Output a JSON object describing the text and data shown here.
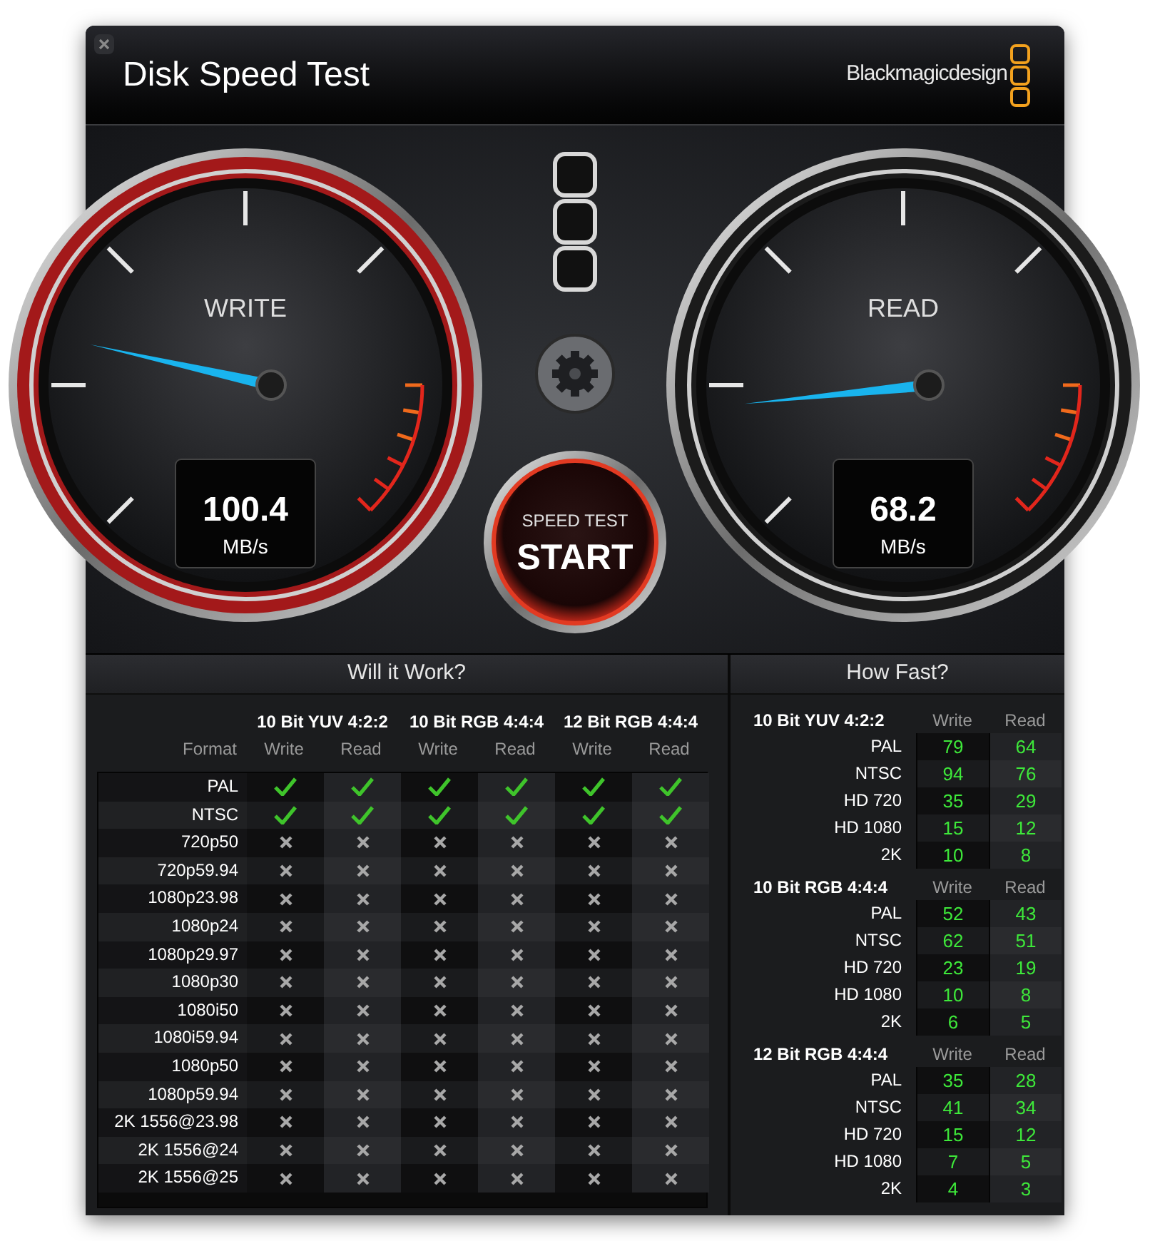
{
  "window": {
    "title": "Disk Speed Test",
    "brand": "Blackmagicdesign"
  },
  "gauges": [
    {
      "label": "WRITE",
      "value": "100.4",
      "unit": "MB/s",
      "color": "#a3191a"
    },
    {
      "label": "READ",
      "value": "68.2",
      "unit": "MB/s",
      "color": "#1b1b1b"
    }
  ],
  "start_button": {
    "caption": "SPEED TEST",
    "label": "START"
  },
  "will_it_work": {
    "title": "Will it Work?",
    "format_header": "Format",
    "groups": [
      {
        "name": "10 Bit YUV 4:2:2",
        "columns": [
          "Write",
          "Read"
        ]
      },
      {
        "name": "10 Bit RGB 4:4:4",
        "columns": [
          "Write",
          "Read"
        ]
      },
      {
        "name": "12 Bit RGB 4:4:4",
        "columns": [
          "Write",
          "Read"
        ]
      }
    ],
    "rows": [
      {
        "format": "PAL",
        "results": [
          true,
          true,
          true,
          true,
          true,
          true
        ]
      },
      {
        "format": "NTSC",
        "results": [
          true,
          true,
          true,
          true,
          true,
          true
        ]
      },
      {
        "format": "720p50",
        "results": [
          false,
          false,
          false,
          false,
          false,
          false
        ]
      },
      {
        "format": "720p59.94",
        "results": [
          false,
          false,
          false,
          false,
          false,
          false
        ]
      },
      {
        "format": "1080p23.98",
        "results": [
          false,
          false,
          false,
          false,
          false,
          false
        ]
      },
      {
        "format": "1080p24",
        "results": [
          false,
          false,
          false,
          false,
          false,
          false
        ]
      },
      {
        "format": "1080p29.97",
        "results": [
          false,
          false,
          false,
          false,
          false,
          false
        ]
      },
      {
        "format": "1080p30",
        "results": [
          false,
          false,
          false,
          false,
          false,
          false
        ]
      },
      {
        "format": "1080i50",
        "results": [
          false,
          false,
          false,
          false,
          false,
          false
        ]
      },
      {
        "format": "1080i59.94",
        "results": [
          false,
          false,
          false,
          false,
          false,
          false
        ]
      },
      {
        "format": "1080p50",
        "results": [
          false,
          false,
          false,
          false,
          false,
          false
        ]
      },
      {
        "format": "1080p59.94",
        "results": [
          false,
          false,
          false,
          false,
          false,
          false
        ]
      },
      {
        "format": "2K 1556@23.98",
        "results": [
          false,
          false,
          false,
          false,
          false,
          false
        ]
      },
      {
        "format": "2K 1556@24",
        "results": [
          false,
          false,
          false,
          false,
          false,
          false
        ]
      },
      {
        "format": "2K 1556@25",
        "results": [
          false,
          false,
          false,
          false,
          false,
          false
        ]
      }
    ]
  },
  "how_fast": {
    "title": "How Fast?",
    "sections": [
      {
        "name": "10 Bit YUV 4:2:2",
        "write_header": "Write",
        "read_header": "Read",
        "rows": [
          {
            "format": "PAL",
            "write": "79",
            "read": "64"
          },
          {
            "format": "NTSC",
            "write": "94",
            "read": "76"
          },
          {
            "format": "HD 720",
            "write": "35",
            "read": "29"
          },
          {
            "format": "HD 1080",
            "write": "15",
            "read": "12"
          },
          {
            "format": "2K",
            "write": "10",
            "read": "8"
          }
        ]
      },
      {
        "name": "10 Bit RGB 4:4:4",
        "write_header": "Write",
        "read_header": "Read",
        "rows": [
          {
            "format": "PAL",
            "write": "52",
            "read": "43"
          },
          {
            "format": "NTSC",
            "write": "62",
            "read": "51"
          },
          {
            "format": "HD 720",
            "write": "23",
            "read": "19"
          },
          {
            "format": "HD 1080",
            "write": "10",
            "read": "8"
          },
          {
            "format": "2K",
            "write": "6",
            "read": "5"
          }
        ]
      },
      {
        "name": "12 Bit RGB 4:4:4",
        "write_header": "Write",
        "read_header": "Read",
        "rows": [
          {
            "format": "PAL",
            "write": "35",
            "read": "28"
          },
          {
            "format": "NTSC",
            "write": "41",
            "read": "34"
          },
          {
            "format": "HD 720",
            "write": "15",
            "read": "12"
          },
          {
            "format": "HD 1080",
            "write": "7",
            "read": "5"
          },
          {
            "format": "2K",
            "write": "4",
            "read": "3"
          }
        ]
      }
    ]
  }
}
